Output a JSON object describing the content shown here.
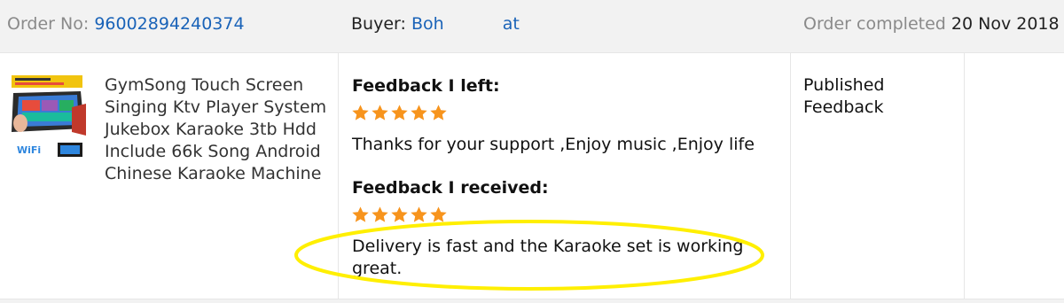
{
  "header": {
    "order_label": "Order No:",
    "order_number": "96002894240374",
    "buyer_label": "Buyer:",
    "buyer_name_first": "Boh",
    "buyer_name_last": "at",
    "status_label": "Order completed",
    "status_date": "20 Nov 2018"
  },
  "product": {
    "title": "GymSong Touch Screen Singing Ktv Player System Jukebox Karaoke 3tb Hdd Include 66k Song Android Chinese Karaoke Machine",
    "thumb_label": "WiFi"
  },
  "feedback": {
    "left_heading": "Feedback I left:",
    "left_stars": 5,
    "left_text": "Thanks for your support ,Enjoy music ,Enjoy life",
    "received_heading": "Feedback I received:",
    "received_stars": 5,
    "received_text": "Delivery is fast and the Karaoke set is working great."
  },
  "status": {
    "text": "Published Feedback"
  },
  "colors": {
    "link": "#1a63b8",
    "star": "#f7941d",
    "highlight": "#ffef00"
  }
}
